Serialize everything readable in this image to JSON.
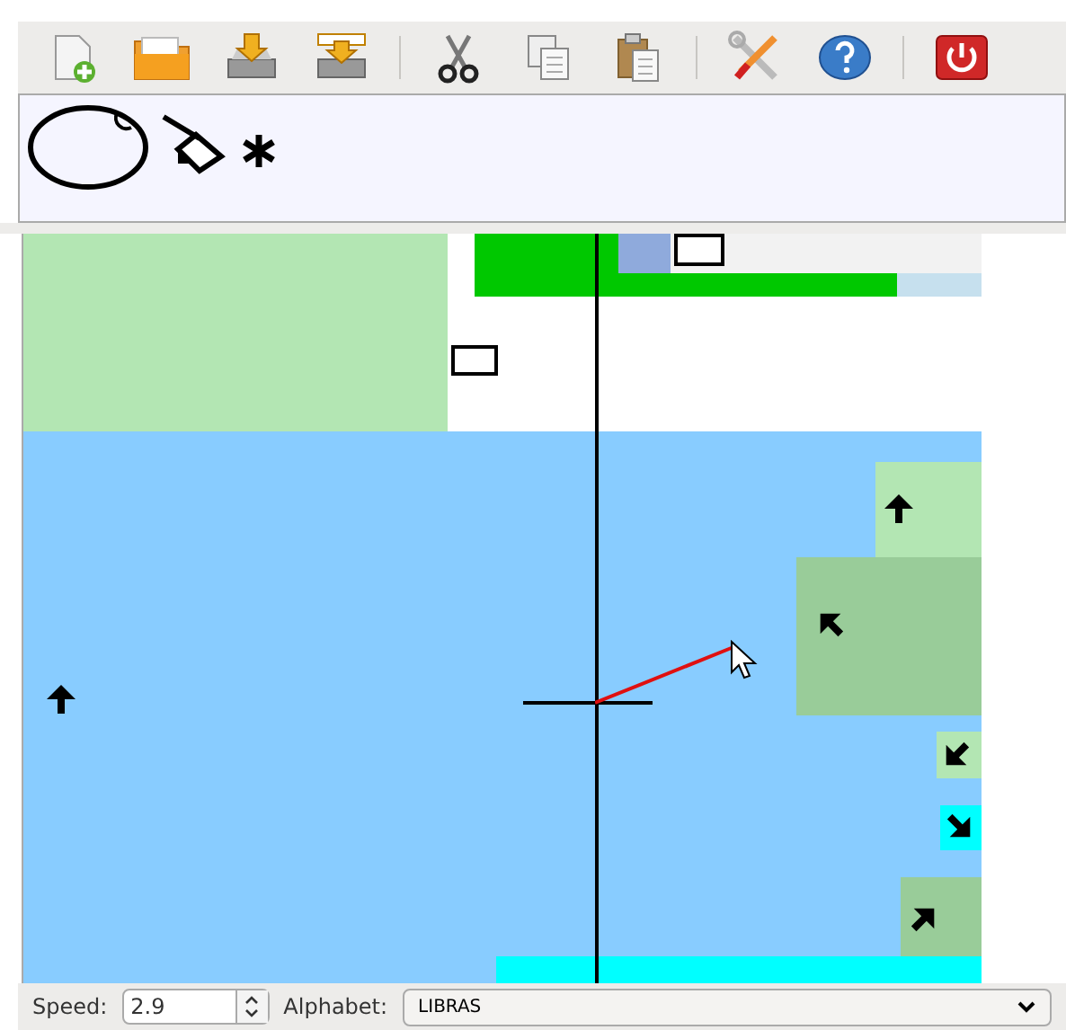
{
  "toolbar": [
    {
      "kind": "new"
    },
    {
      "kind": "open"
    },
    {
      "kind": "save"
    },
    {
      "kind": "save-as"
    },
    {
      "kind": "separator"
    },
    {
      "kind": "cut"
    },
    {
      "kind": "copy"
    },
    {
      "kind": "paste"
    },
    {
      "kind": "separator"
    },
    {
      "kind": "preferences"
    },
    {
      "kind": "help"
    },
    {
      "kind": "separator"
    },
    {
      "kind": "quit"
    }
  ],
  "status_bar": {
    "speed_label": "Speed:",
    "speed": "2.9",
    "alphabet_label": "Alphabet:",
    "alphabet": "LIBRAS"
  }
}
